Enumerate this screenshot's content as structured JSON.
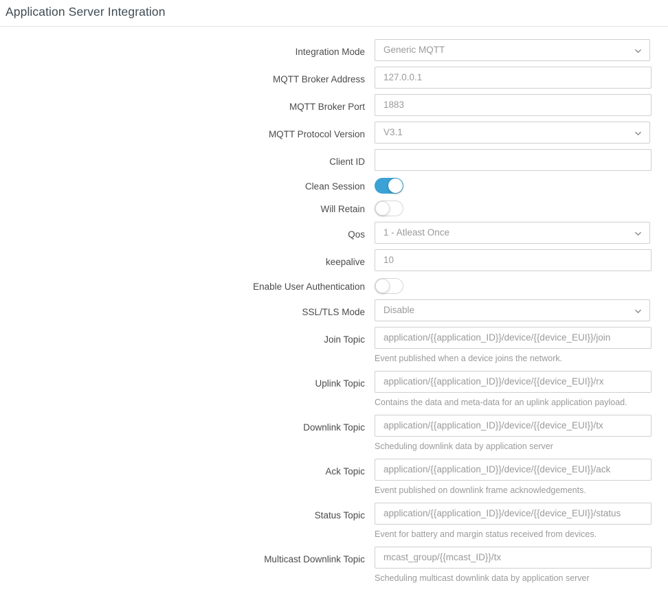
{
  "header": {
    "title": "Application Server Integration"
  },
  "form": {
    "rows": [
      {
        "id": "integration-mode",
        "label": "Integration Mode",
        "type": "select",
        "value": "Generic MQTT",
        "options": [
          "Generic MQTT"
        ],
        "help": ""
      },
      {
        "id": "mqtt-broker-address",
        "label": "MQTT Broker Address",
        "type": "text",
        "value": "127.0.0.1",
        "help": ""
      },
      {
        "id": "mqtt-broker-port",
        "label": "MQTT Broker Port",
        "type": "text",
        "value": "1883",
        "help": ""
      },
      {
        "id": "mqtt-protocol-version",
        "label": "MQTT Protocol Version",
        "type": "select",
        "value": "V3.1",
        "options": [
          "V3.1"
        ],
        "help": ""
      },
      {
        "id": "client-id",
        "label": "Client ID",
        "type": "text",
        "value": "",
        "help": ""
      },
      {
        "id": "clean-session",
        "label": "Clean Session",
        "type": "toggle",
        "value": "on",
        "help": ""
      },
      {
        "id": "will-retain",
        "label": "Will Retain",
        "type": "toggle",
        "value": "off",
        "help": ""
      },
      {
        "id": "qos",
        "label": "Qos",
        "type": "select",
        "value": "1 - Atleast Once",
        "options": [
          "1 - Atleast Once"
        ],
        "help": ""
      },
      {
        "id": "keepalive",
        "label": "keepalive",
        "type": "text",
        "value": "10",
        "help": ""
      },
      {
        "id": "enable-user-authentication",
        "label": "Enable User Authentication",
        "type": "toggle",
        "value": "off",
        "help": ""
      },
      {
        "id": "ssl-tls-mode",
        "label": "SSL/TLS Mode",
        "type": "select",
        "value": "Disable",
        "options": [
          "Disable"
        ],
        "help": ""
      },
      {
        "id": "join-topic",
        "label": "Join Topic",
        "type": "text",
        "value": "application/{{application_ID}}/device/{{device_EUI}}/join",
        "help": "Event published when a device joins the network."
      },
      {
        "id": "uplink-topic",
        "label": "Uplink Topic",
        "type": "text",
        "value": "application/{{application_ID}}/device/{{device_EUI}}/rx",
        "help": "Contains the data and meta-data for an uplink application payload."
      },
      {
        "id": "downlink-topic",
        "label": "Downlink Topic",
        "type": "text",
        "value": "application/{{application_ID}}/device/{{device_EUI}}/tx",
        "help": "Scheduling downlink data by application server"
      },
      {
        "id": "ack-topic",
        "label": "Ack Topic",
        "type": "text",
        "value": "application/{{application_ID}}/device/{{device_EUI}}/ack",
        "help": "Event published on downlink frame acknowledgements."
      },
      {
        "id": "status-topic",
        "label": "Status Topic",
        "type": "text",
        "value": "application/{{application_ID}}/device/{{device_EUI}}/status",
        "help": "Event for battery and margin status received from devices."
      },
      {
        "id": "multicast-downlink-topic",
        "label": "Multicast Downlink Topic",
        "type": "text",
        "value": "mcast_group/{{mcast_ID}}/tx",
        "help": "Scheduling multicast downlink data by application server"
      }
    ]
  },
  "colors": {
    "toggle_on": "#3aa2d4",
    "border": "#cfcfcf",
    "header_border": "#e4e6e8",
    "title_text": "#3e4b54",
    "label_text": "#4b4b4b",
    "value_text": "#9a9a9a"
  },
  "icons": {
    "chevron_down": "chevron-down-icon"
  }
}
